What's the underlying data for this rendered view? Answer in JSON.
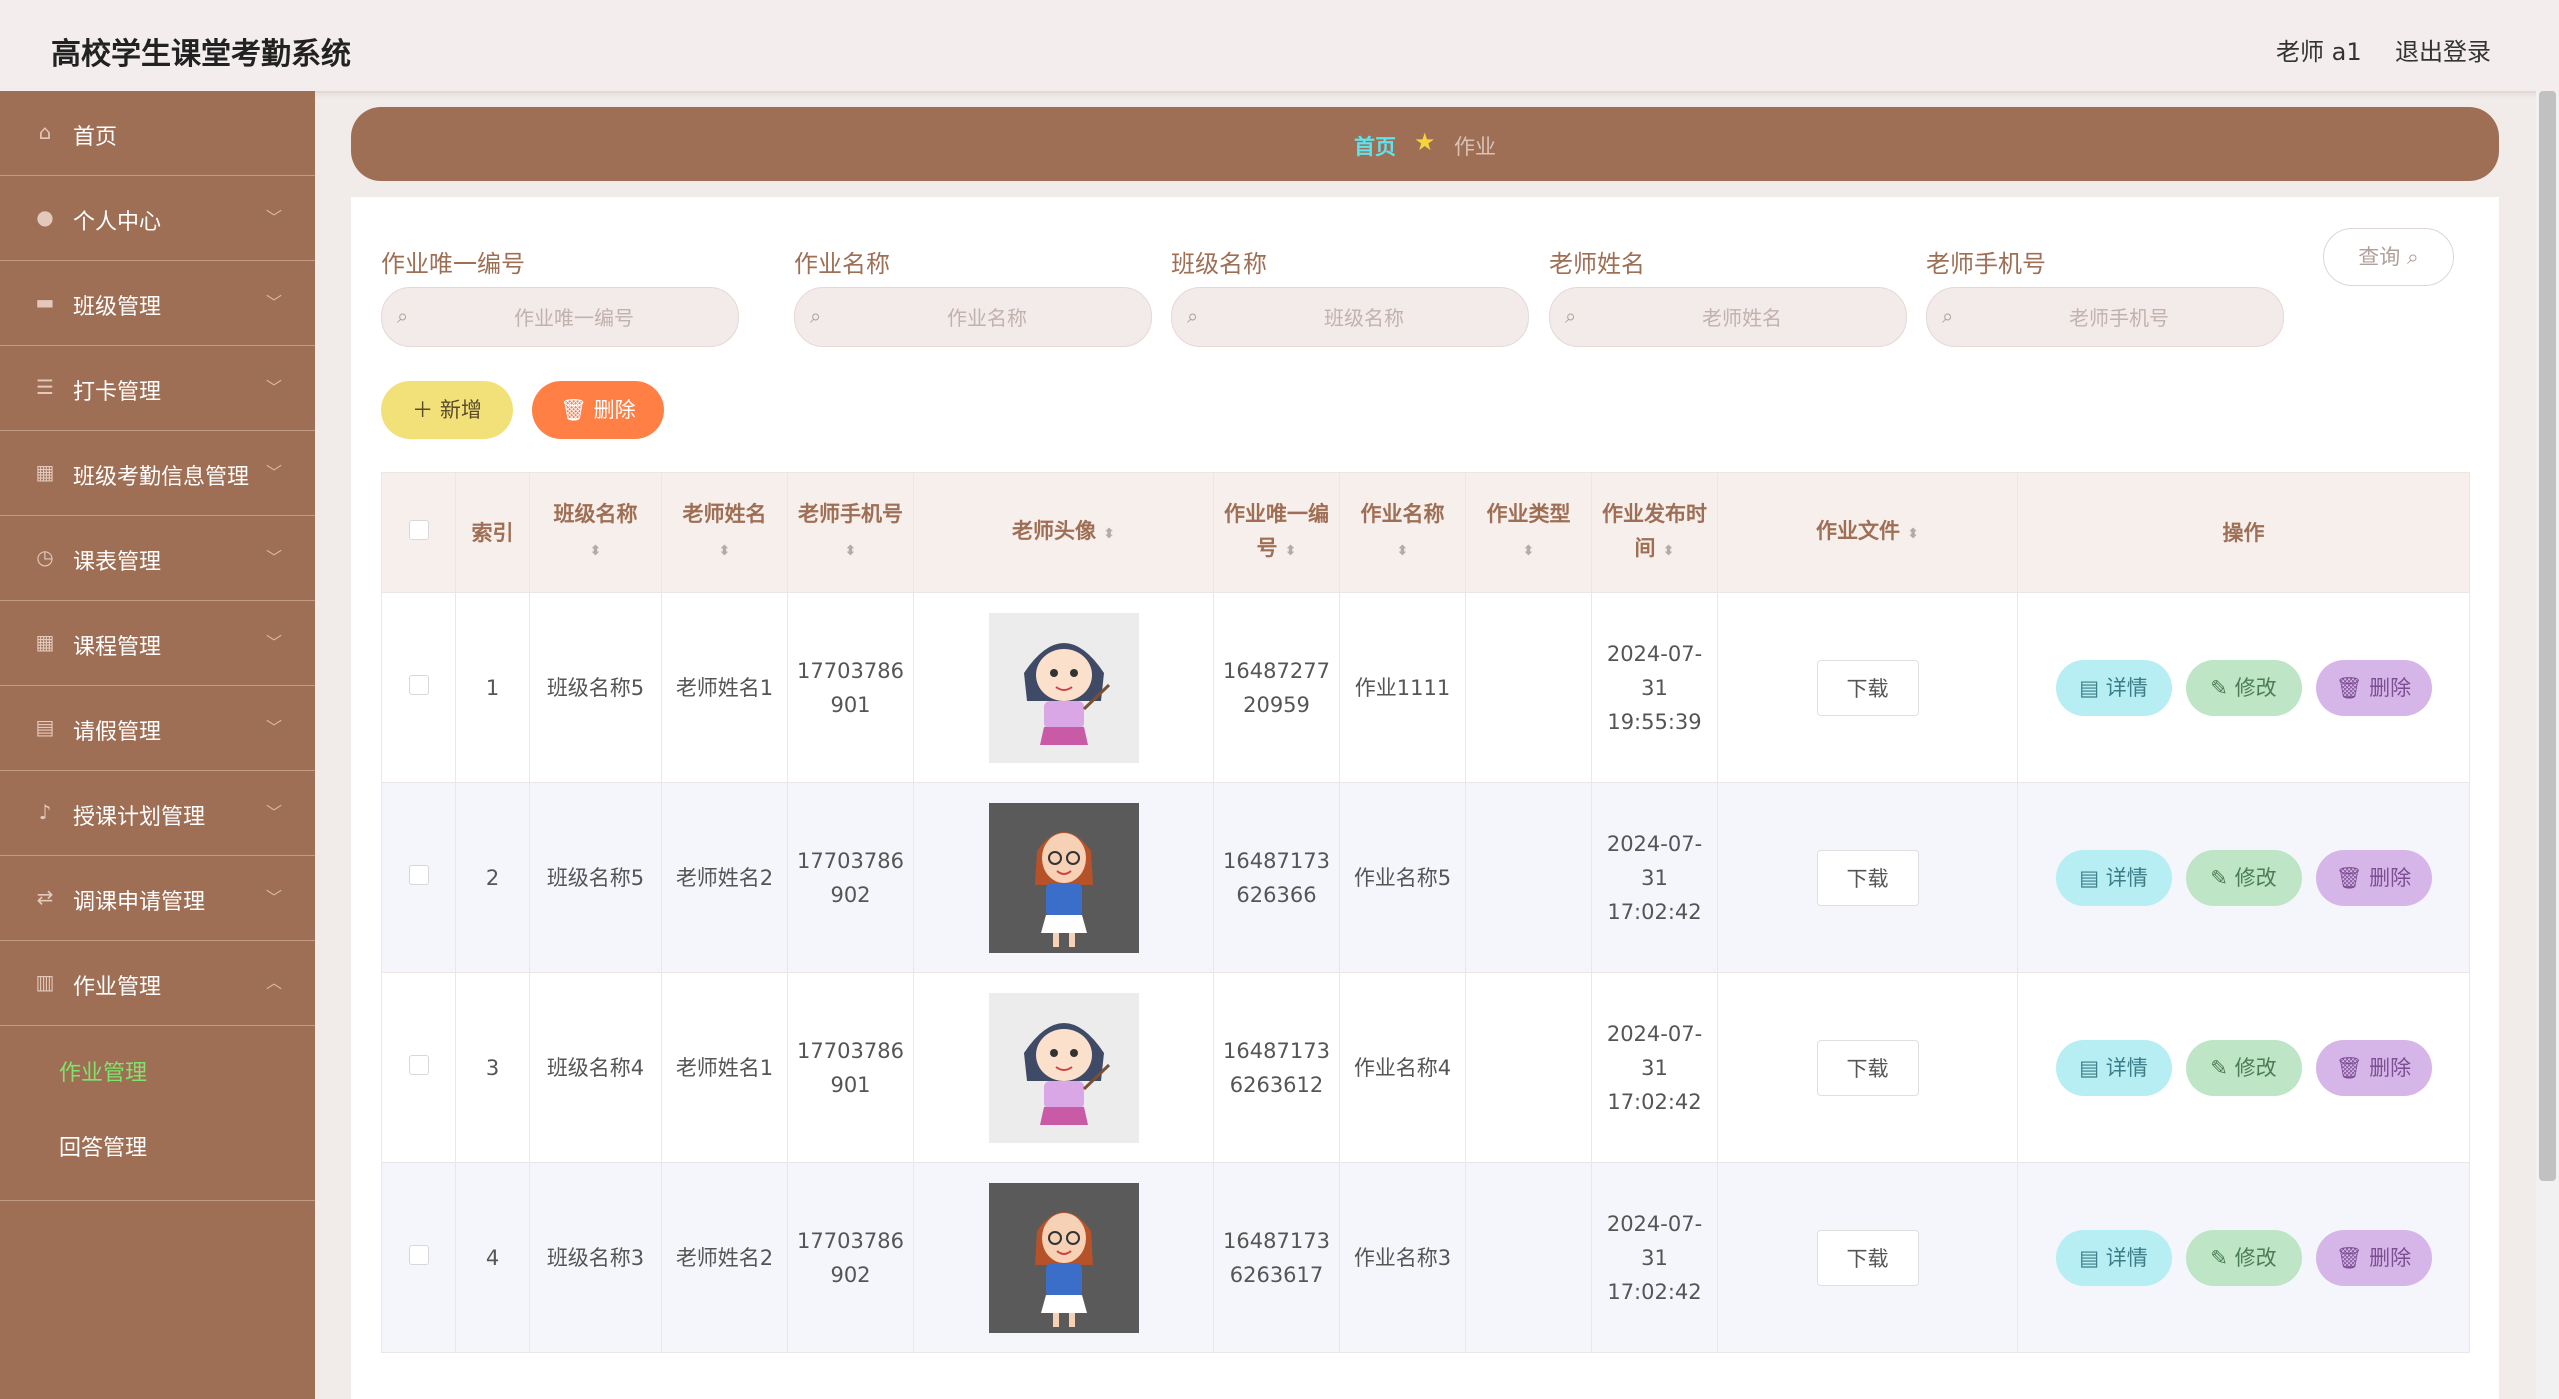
{
  "app": {
    "title": "高校学生课堂考勤系统",
    "user": "老师 a1",
    "logout": "退出登录"
  },
  "sidebar": {
    "items": [
      {
        "label": "首页",
        "icon": "home-icon",
        "glyph": "⌂",
        "has_arrow": false
      },
      {
        "label": "个人中心",
        "icon": "user-icon",
        "glyph": "●",
        "has_arrow": true
      },
      {
        "label": "班级管理",
        "icon": "flag-icon",
        "glyph": "▬",
        "has_arrow": true
      },
      {
        "label": "打卡管理",
        "icon": "sliders-icon",
        "glyph": "☰",
        "has_arrow": true
      },
      {
        "label": "班级考勤信息管理",
        "icon": "chart-icon",
        "glyph": "▦",
        "has_arrow": true
      },
      {
        "label": "课表管理",
        "icon": "clock-icon",
        "glyph": "◷",
        "has_arrow": true
      },
      {
        "label": "课程管理",
        "icon": "grid-icon",
        "glyph": "▦",
        "has_arrow": true
      },
      {
        "label": "请假管理",
        "icon": "calendar-icon",
        "glyph": "▤",
        "has_arrow": true
      },
      {
        "label": "授课计划管理",
        "icon": "microphone-icon",
        "glyph": "♪",
        "has_arrow": true
      },
      {
        "label": "调课申请管理",
        "icon": "swap-icon",
        "glyph": "⇄",
        "has_arrow": true
      },
      {
        "label": "作业管理",
        "icon": "document-icon",
        "glyph": "▥",
        "has_arrow": true,
        "expanded": true
      }
    ],
    "sub_items": [
      {
        "label": "作业管理",
        "active": true
      },
      {
        "label": "回答管理",
        "active": false
      }
    ]
  },
  "breadcrumb": {
    "home": "首页",
    "current": "作业"
  },
  "filters": [
    {
      "label": "作业唯一编号",
      "placeholder": "作业唯一编号"
    },
    {
      "label": "作业名称",
      "placeholder": "作业名称"
    },
    {
      "label": "班级名称",
      "placeholder": "班级名称"
    },
    {
      "label": "老师姓名",
      "placeholder": "老师姓名"
    },
    {
      "label": "老师手机号",
      "placeholder": "老师手机号"
    }
  ],
  "buttons": {
    "query": "查询",
    "add": "新增",
    "delete": "删除"
  },
  "table": {
    "headers": {
      "index": "索引",
      "class_name": "班级名称",
      "teacher_name": "老师姓名",
      "teacher_phone": "老师手机号",
      "avatar": "老师头像",
      "hw_id": "作业唯一编号",
      "hw_name": "作业名称",
      "hw_type": "作业类型",
      "publish_time": "作业发布时间",
      "hw_file": "作业文件",
      "actions": "操作"
    },
    "rows": [
      {
        "index": "1",
        "class_name": "班级名称5",
        "teacher_name": "老师姓名1",
        "teacher_phone": "17703786901",
        "avatar": "teacher-avatar-1",
        "hw_id": "1648727720959",
        "hw_name": "作业1111",
        "hw_type": "",
        "publish_time": "2024-07-31 19:55:39"
      },
      {
        "index": "2",
        "class_name": "班级名称5",
        "teacher_name": "老师姓名2",
        "teacher_phone": "17703786902",
        "avatar": "teacher-avatar-2",
        "hw_id": "16487173626366",
        "hw_name": "作业名称5",
        "hw_type": "",
        "publish_time": "2024-07-31 17:02:42"
      },
      {
        "index": "3",
        "class_name": "班级名称4",
        "teacher_name": "老师姓名1",
        "teacher_phone": "17703786901",
        "avatar": "teacher-avatar-1",
        "hw_id": "164871736263612",
        "hw_name": "作业名称4",
        "hw_type": "",
        "publish_time": "2024-07-31 17:02:42"
      },
      {
        "index": "4",
        "class_name": "班级名称3",
        "teacher_name": "老师姓名2",
        "teacher_phone": "17703786902",
        "avatar": "teacher-avatar-2",
        "hw_id": "164871736263617",
        "hw_name": "作业名称3",
        "hw_type": "",
        "publish_time": "2024-07-31 17:02:42"
      }
    ],
    "row_actions": {
      "download": "下载",
      "detail": "详情",
      "edit": "修改",
      "delete": "删除"
    }
  },
  "colors": {
    "brand": "#9f6f55",
    "active_submenu": "#7fe36c",
    "breadcrumb_home": "#5fe3ee",
    "add": "#f2e179",
    "delete": "#ff7f45"
  }
}
